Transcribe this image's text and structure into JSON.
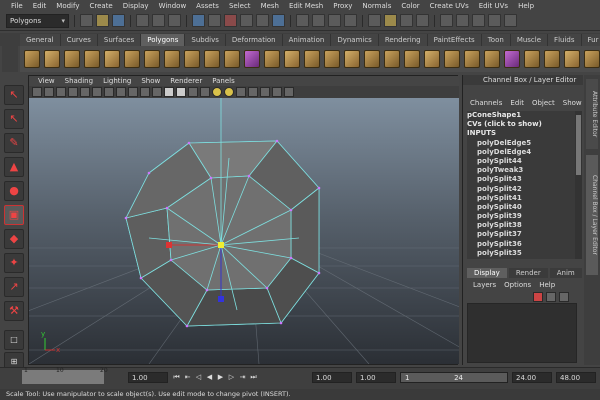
{
  "menubar": [
    "File",
    "Edit",
    "Modify",
    "Create",
    "Display",
    "Window",
    "Assets",
    "Select",
    "Mesh",
    "Edit Mesh",
    "Proxy",
    "Normals",
    "Color",
    "Create UVs",
    "Edit UVs",
    "Help"
  ],
  "mode_selector": "Polygons",
  "shelf_tabs": [
    "General",
    "Curves",
    "Surfaces",
    "Polygons",
    "Subdivs",
    "Deformation",
    "Animation",
    "Dynamics",
    "Rendering",
    "PaintEffects",
    "Toon",
    "Muscle",
    "Fluids",
    "Fur"
  ],
  "active_shelf_tab": "Polygons",
  "panel_menu": [
    "View",
    "Shading",
    "Lighting",
    "Show",
    "Renderer",
    "Panels"
  ],
  "channel_box": {
    "title": "Channel Box / Layer Editor",
    "menu": [
      "Channels",
      "Edit",
      "Object",
      "Show"
    ],
    "object_name": "pConeShape1",
    "cvs": "CVs (click to show)",
    "inputs_label": "INPUTS",
    "nodes": [
      "polyDelEdge5",
      "polyDelEdge4",
      "polySplit44",
      "polyTweak3",
      "polySplit43",
      "polySplit42",
      "polySplit41",
      "polySplit40",
      "polySplit39",
      "polySplit38",
      "polySplit37",
      "polySplit36",
      "polySplit35"
    ]
  },
  "layer_editor": {
    "tabs": [
      "Display",
      "Render",
      "Anim"
    ],
    "active_tab": "Display",
    "menu": [
      "Layers",
      "Options",
      "Help"
    ]
  },
  "side_tabs": [
    "Attribute Editor",
    "Channel Box / Layer Editor"
  ],
  "timeline": {
    "ticks": [
      "1",
      "10",
      "20"
    ],
    "start_field": "1.00",
    "current_field": "1.00",
    "range_start": "1.00",
    "range_start2": "1.00",
    "range_slider_start": "1",
    "range_slider_end": "24",
    "end_time": "24.00",
    "end_time2": "48.00"
  },
  "help_line": "Scale Tool: Use manipulator to scale object(s). Use edit mode to change pivot (INSERT).",
  "axis": {
    "x": "x",
    "y": "y"
  }
}
